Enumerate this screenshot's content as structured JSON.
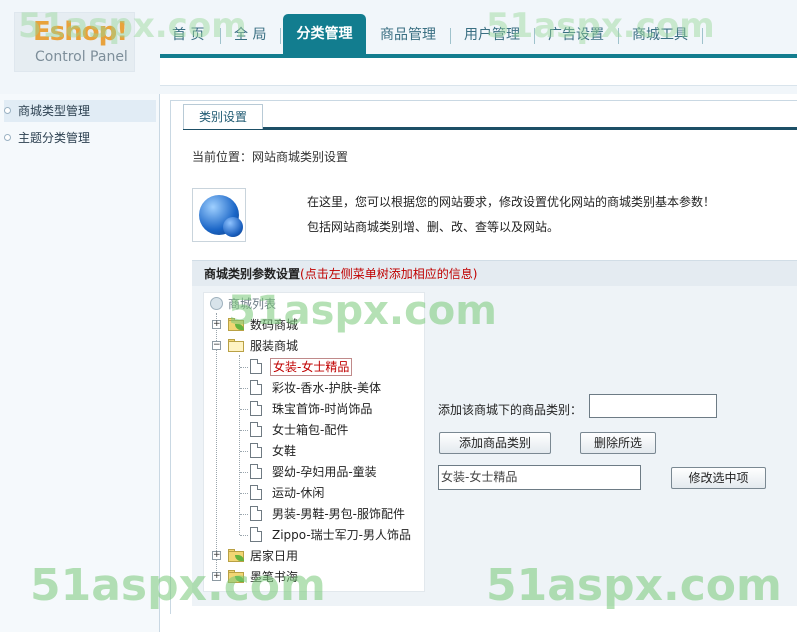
{
  "app": {
    "logo_title": "Eshop!",
    "logo_subtitle": "Control Panel",
    "accent_color": "#127d8f"
  },
  "nav": {
    "items": [
      "首 页",
      "全 局",
      "分类管理",
      "商品管理",
      "用户管理",
      "广告设置",
      "商城工具"
    ],
    "active": "分类管理"
  },
  "sidebar": {
    "items": [
      {
        "label": "商城类型管理",
        "selected": true
      },
      {
        "label": "主题分类管理",
        "selected": false
      }
    ]
  },
  "main": {
    "tab_label": "类别设置",
    "breadcrumb": "当前位置：网站商城类别设置",
    "intro_line1": "在这里，您可以根据您的网站要求，修改设置优化网站的商城类别基本参数！",
    "intro_line2": "包括网站商城类别增、删、改、查等以及网站。",
    "panel_title": "商城类别参数设置",
    "panel_hint": "(点击左侧菜单树添加相应的信息)"
  },
  "tree": {
    "root": "商城列表",
    "nodes": [
      {
        "label": "数码商城",
        "expanded": false
      },
      {
        "label": "服装商城",
        "expanded": true
      },
      {
        "label": "居家日用",
        "expanded": false
      },
      {
        "label": "墨笔书海",
        "expanded": false
      }
    ],
    "children": [
      "女装-女士精品",
      "彩妆-香水-护肤-美体",
      "珠宝首饰-时尚饰品",
      "女士箱包-配件",
      "女鞋",
      "婴幼-孕妇用品-童装",
      "运动-休闲",
      "男装-男鞋-男包-服饰配件",
      "Zippo-瑞士军刀-男人饰品"
    ],
    "selected_child": "女装-女士精品"
  },
  "form": {
    "add_label": "添加该商城下的商品类别：",
    "add_input_value": "",
    "add_button": "添加商品类别",
    "delete_all_button": "删除所选",
    "selected_value": "女装-女士精品",
    "modify_button": "修改选中项"
  },
  "watermarks": [
    "51aspx.com",
    "51aspx.com",
    "51aspx.com",
    "51aspx.com",
    "51aspx.com"
  ]
}
